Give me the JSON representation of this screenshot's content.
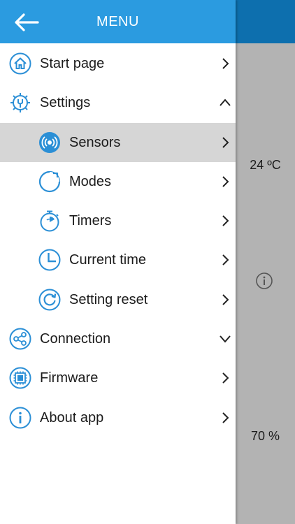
{
  "background": {
    "temperature": "24 ºC",
    "humidity": "70 %"
  },
  "header": {
    "title": "MENU"
  },
  "menu": {
    "items": [
      {
        "label": "Start page",
        "icon": "home-icon",
        "chevron": "right"
      },
      {
        "label": "Settings",
        "icon": "gear-icon",
        "chevron": "up"
      },
      {
        "label": "Sensors",
        "icon": "sensor-icon",
        "chevron": "right",
        "active": true
      },
      {
        "label": "Modes",
        "icon": "modes-icon",
        "chevron": "right"
      },
      {
        "label": "Timers",
        "icon": "timer-icon",
        "chevron": "right"
      },
      {
        "label": "Current time",
        "icon": "clock-icon",
        "chevron": "right"
      },
      {
        "label": "Setting reset",
        "icon": "reset-icon",
        "chevron": "right"
      },
      {
        "label": "Connection",
        "icon": "share-icon",
        "chevron": "down"
      },
      {
        "label": "Firmware",
        "icon": "chip-icon",
        "chevron": "right"
      },
      {
        "label": "About app",
        "icon": "info-icon",
        "chevron": "right"
      }
    ]
  },
  "colors": {
    "accent": "#2b9be0",
    "icon": "#2b8fd6",
    "active_row": "#d6d6d6",
    "background_app_header": "#0d6fae",
    "background_app_body": "#b3b3b3"
  }
}
